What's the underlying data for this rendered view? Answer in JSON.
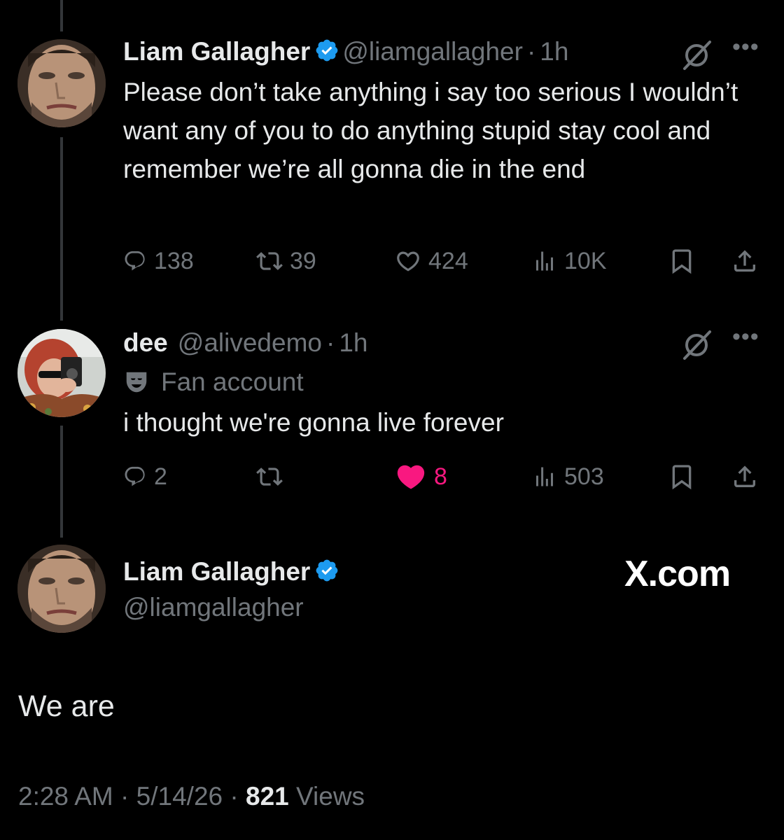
{
  "colors": {
    "background": "#000000",
    "text": "#e7e9ea",
    "muted": "#71767b",
    "verified": "#1d9bf0",
    "like_active": "#f91880",
    "thread_line": "#333639"
  },
  "thread": [
    {
      "author": {
        "name": "Liam Gallagher",
        "handle": "@liamgallagher",
        "verified": true,
        "avatar_icon": "avatar-photo"
      },
      "time": "1h",
      "separator": "·",
      "text": "Please don’t take anything i say too serious I wouldn’t want any of you to do anything stupid stay cool and remember we’re all gonna die in the end",
      "actions": {
        "replies": "138",
        "reposts": "39",
        "likes": "424",
        "views": "10K",
        "liked": false
      }
    },
    {
      "author": {
        "name": "dee",
        "handle": "@alivedemo",
        "verified": false,
        "avatar_icon": "avatar-photo"
      },
      "time": "1h",
      "separator": "·",
      "badge": {
        "icon": "theater-mask-icon",
        "label": "Fan account"
      },
      "text": "i thought we're gonna live forever",
      "actions": {
        "replies": "2",
        "reposts": "",
        "likes": "8",
        "views": "503",
        "liked": true
      }
    }
  ],
  "main_tweet": {
    "author": {
      "name": "Liam Gallagher",
      "handle": "@liamgallagher",
      "verified": true
    },
    "text": "We are",
    "time": "2:28 AM",
    "date": "5/14/26",
    "separator": "·",
    "views_count": "821",
    "views_label": "Views"
  },
  "watermark": "X.com"
}
